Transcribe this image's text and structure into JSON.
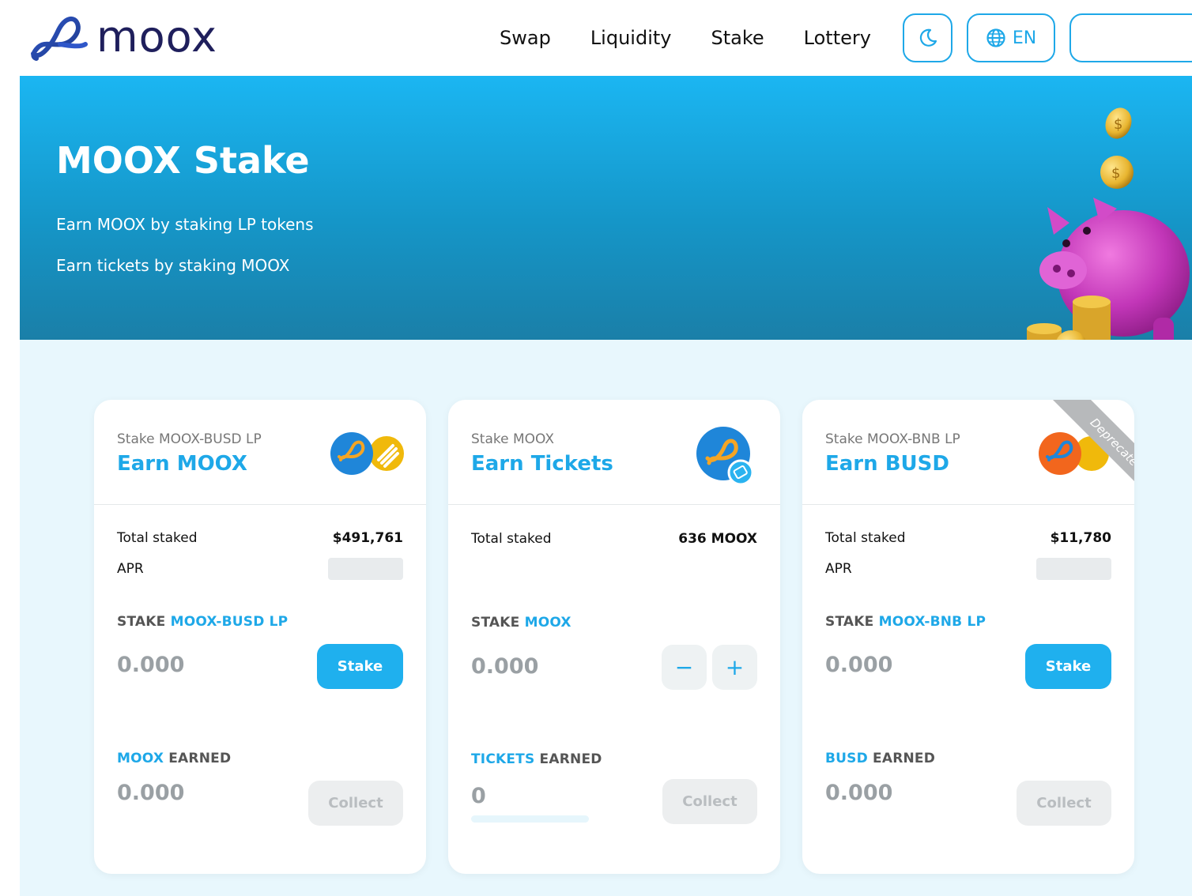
{
  "app": {
    "name": "moox"
  },
  "nav": {
    "items": [
      "Swap",
      "Liquidity",
      "Stake",
      "Lottery"
    ]
  },
  "header": {
    "lang_label": "EN"
  },
  "hero": {
    "title": "MOOX Stake",
    "line1": "Earn MOOX by staking LP tokens",
    "line2": "Earn tickets by staking MOOX"
  },
  "cards": [
    {
      "subtitle": "Stake MOOX-BUSD LP",
      "title": "Earn MOOX",
      "total_staked_label": "Total staked",
      "total_staked_value": "$491,761",
      "apr_label": "APR",
      "stake_prefix": "STAKE ",
      "stake_token": "MOOX-BUSD LP",
      "stake_amount": "0.000",
      "stake_button": "Stake",
      "earned_token": "MOOX",
      "earned_suffix": " EARNED",
      "earned_amount": "0.000",
      "collect_button": "Collect"
    },
    {
      "subtitle": "Stake MOOX",
      "title": "Earn Tickets",
      "total_staked_label": "Total staked",
      "total_staked_value": "636 MOOX",
      "stake_prefix": "STAKE ",
      "stake_token": "MOOX",
      "stake_amount": "0.000",
      "minus_label": "−",
      "plus_label": "+",
      "earned_token": "TICKETS",
      "earned_suffix": " EARNED",
      "earned_amount": "0",
      "collect_button": "Collect"
    },
    {
      "subtitle": "Stake MOOX-BNB LP",
      "title": "Earn BUSD",
      "ribbon": "Deprecated",
      "total_staked_label": "Total staked",
      "total_staked_value": "$11,780",
      "apr_label": "APR",
      "stake_prefix": "STAKE ",
      "stake_token": "MOOX-BNB LP",
      "stake_amount": "0.000",
      "stake_button": "Stake",
      "earned_token": "BUSD",
      "earned_suffix": " EARNED",
      "earned_amount": "0.000",
      "collect_button": "Collect"
    }
  ],
  "colors": {
    "accent": "#1ea8e8",
    "hero_top": "#1bb6f2",
    "hero_bottom": "#1a7fa8",
    "content_bg": "#e8f7fd",
    "logo_text": "#1f1f5c"
  },
  "icons": {
    "logo": "moox-infinity-logo",
    "theme": "moon-icon",
    "lang": "globe-icon",
    "hero_illustration": "piggy-bank-with-coins"
  }
}
